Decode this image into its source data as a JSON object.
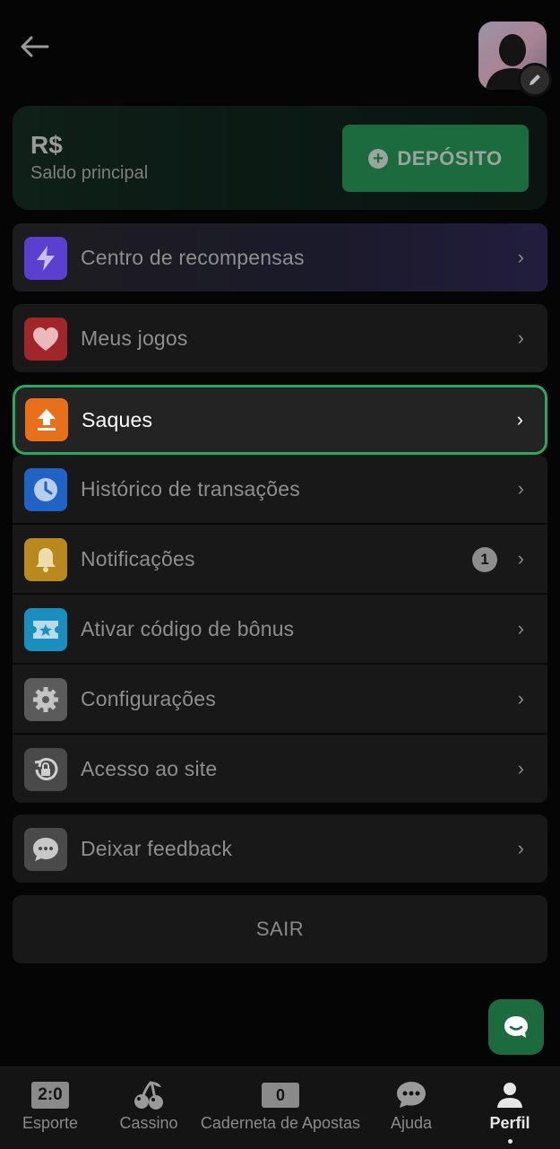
{
  "header": {
    "back_icon": "arrow-left-icon",
    "avatar_icon": "user-silhouette",
    "edit_icon": "pencil-icon"
  },
  "balance": {
    "currency": "R$",
    "subtitle": "Saldo principal",
    "deposit_label": "DEPÓSITO",
    "deposit_color": "#1b6b3e"
  },
  "menu": {
    "rewards": {
      "label": "Centro de recompensas",
      "icon": "lightning-icon",
      "color": "#5b3fd0"
    },
    "my_games": {
      "label": "Meus jogos",
      "icon": "heart-icon",
      "color": "#a0262a"
    },
    "withdrawals": {
      "label": "Saques",
      "icon": "upload-icon",
      "color": "#e8701a",
      "highlight_color": "#2aa862"
    },
    "history": {
      "label": "Histórico de transações",
      "icon": "clock-icon",
      "color": "#1f64c4"
    },
    "notifications": {
      "label": "Notificações",
      "icon": "bell-icon",
      "color": "#b8891c",
      "count": "1"
    },
    "bonus": {
      "label": "Ativar código de bônus",
      "icon": "ticket-star-icon",
      "color": "#1a8fbf"
    },
    "settings": {
      "label": "Configurações",
      "icon": "gear-icon",
      "color": "#5b5b5b"
    },
    "site_access": {
      "label": "Acesso ao site",
      "icon": "lock-history-icon",
      "color": "#4a4a4a"
    },
    "feedback": {
      "label": "Deixar feedback",
      "icon": "chat-bubble-icon",
      "color": "#4a4a4a"
    }
  },
  "logout_label": "SAIR",
  "chat_fab_icon": "chat-icon",
  "bottom_nav": {
    "sport": {
      "label": "Esporte",
      "score": "2:0"
    },
    "casino": {
      "label": "Cassino",
      "icon": "cherries-icon"
    },
    "betslip": {
      "label": "Caderneta de Apostas",
      "count": "0"
    },
    "help": {
      "label": "Ajuda",
      "icon": "chat-icon"
    },
    "profile": {
      "label": "Perfil",
      "icon": "person-icon",
      "active": true
    }
  }
}
